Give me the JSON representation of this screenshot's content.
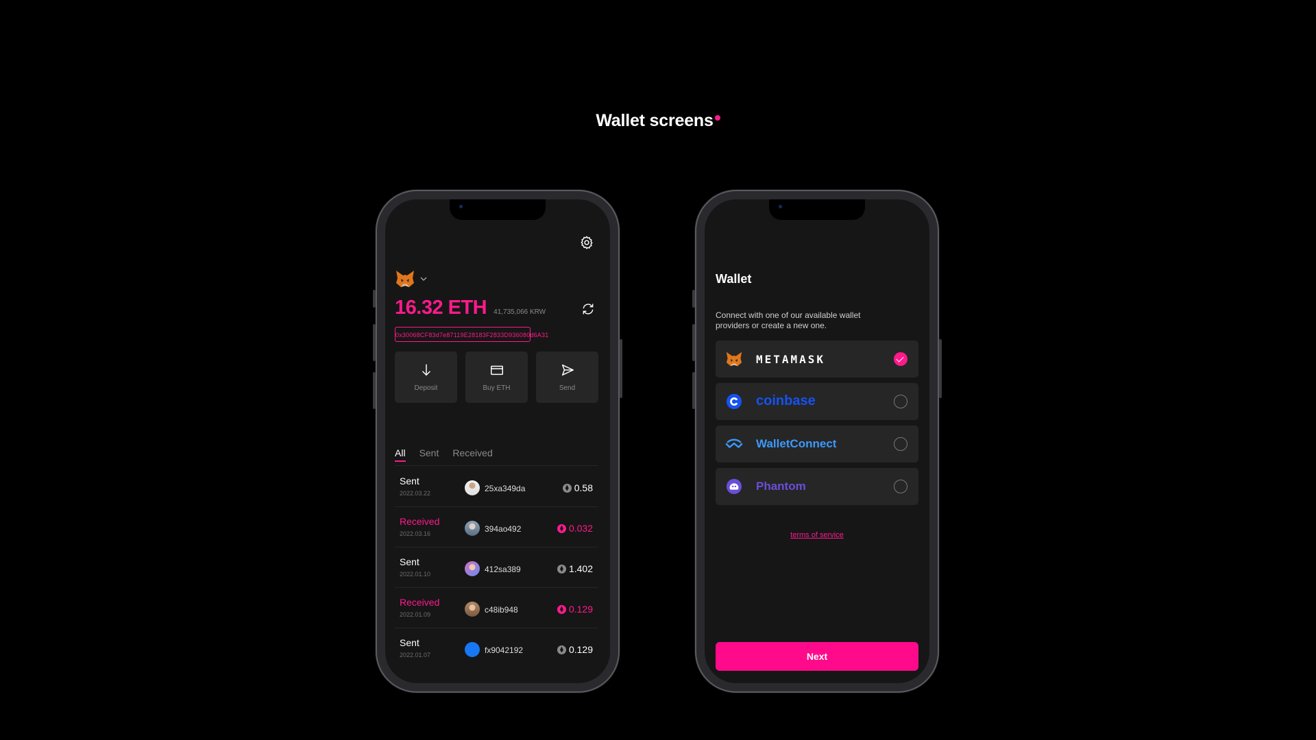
{
  "page": {
    "title": "Wallet screens"
  },
  "colors": {
    "accent": "#ff1a8c",
    "background": "#000000",
    "screen": "#161616",
    "card": "#262626"
  },
  "wallet_home": {
    "balance": "16.32 ETH",
    "balance_fiat": "41,735,066 KRW",
    "address": "0x30068CF83d7e87119E28183F2833D936080d6A31",
    "actions": [
      {
        "label": "Deposit",
        "icon": "arrow-down-icon"
      },
      {
        "label": "Buy ETH",
        "icon": "card-icon"
      },
      {
        "label": "Send",
        "icon": "send-icon"
      }
    ],
    "tabs": [
      "All",
      "Sent",
      "Received"
    ],
    "active_tab": "All",
    "transactions": [
      {
        "type": "Sent",
        "date": "2022.03.22",
        "address": "25xa349da",
        "amount": "0.58"
      },
      {
        "type": "Received",
        "date": "2022.03.16",
        "address": "394ao492",
        "amount": "0.032"
      },
      {
        "type": "Sent",
        "date": "2022.01.10",
        "address": "412sa389",
        "amount": "1.402"
      },
      {
        "type": "Received",
        "date": "2022.01.09",
        "address": "c48ib948",
        "amount": "0.129"
      },
      {
        "type": "Sent",
        "date": "2022.01.07",
        "address": "fx9042192",
        "amount": "0.129"
      }
    ]
  },
  "wallet_connect": {
    "title": "Wallet",
    "description": "Connect with one of our available wallet providers or create a new one.",
    "providers": [
      {
        "name": "METAMASK",
        "selected": true
      },
      {
        "name": "coinbase",
        "selected": false
      },
      {
        "name": "WalletConnect",
        "selected": false
      },
      {
        "name": "Phantom",
        "selected": false
      }
    ],
    "terms_link": "terms of service",
    "next_label": "Next"
  }
}
